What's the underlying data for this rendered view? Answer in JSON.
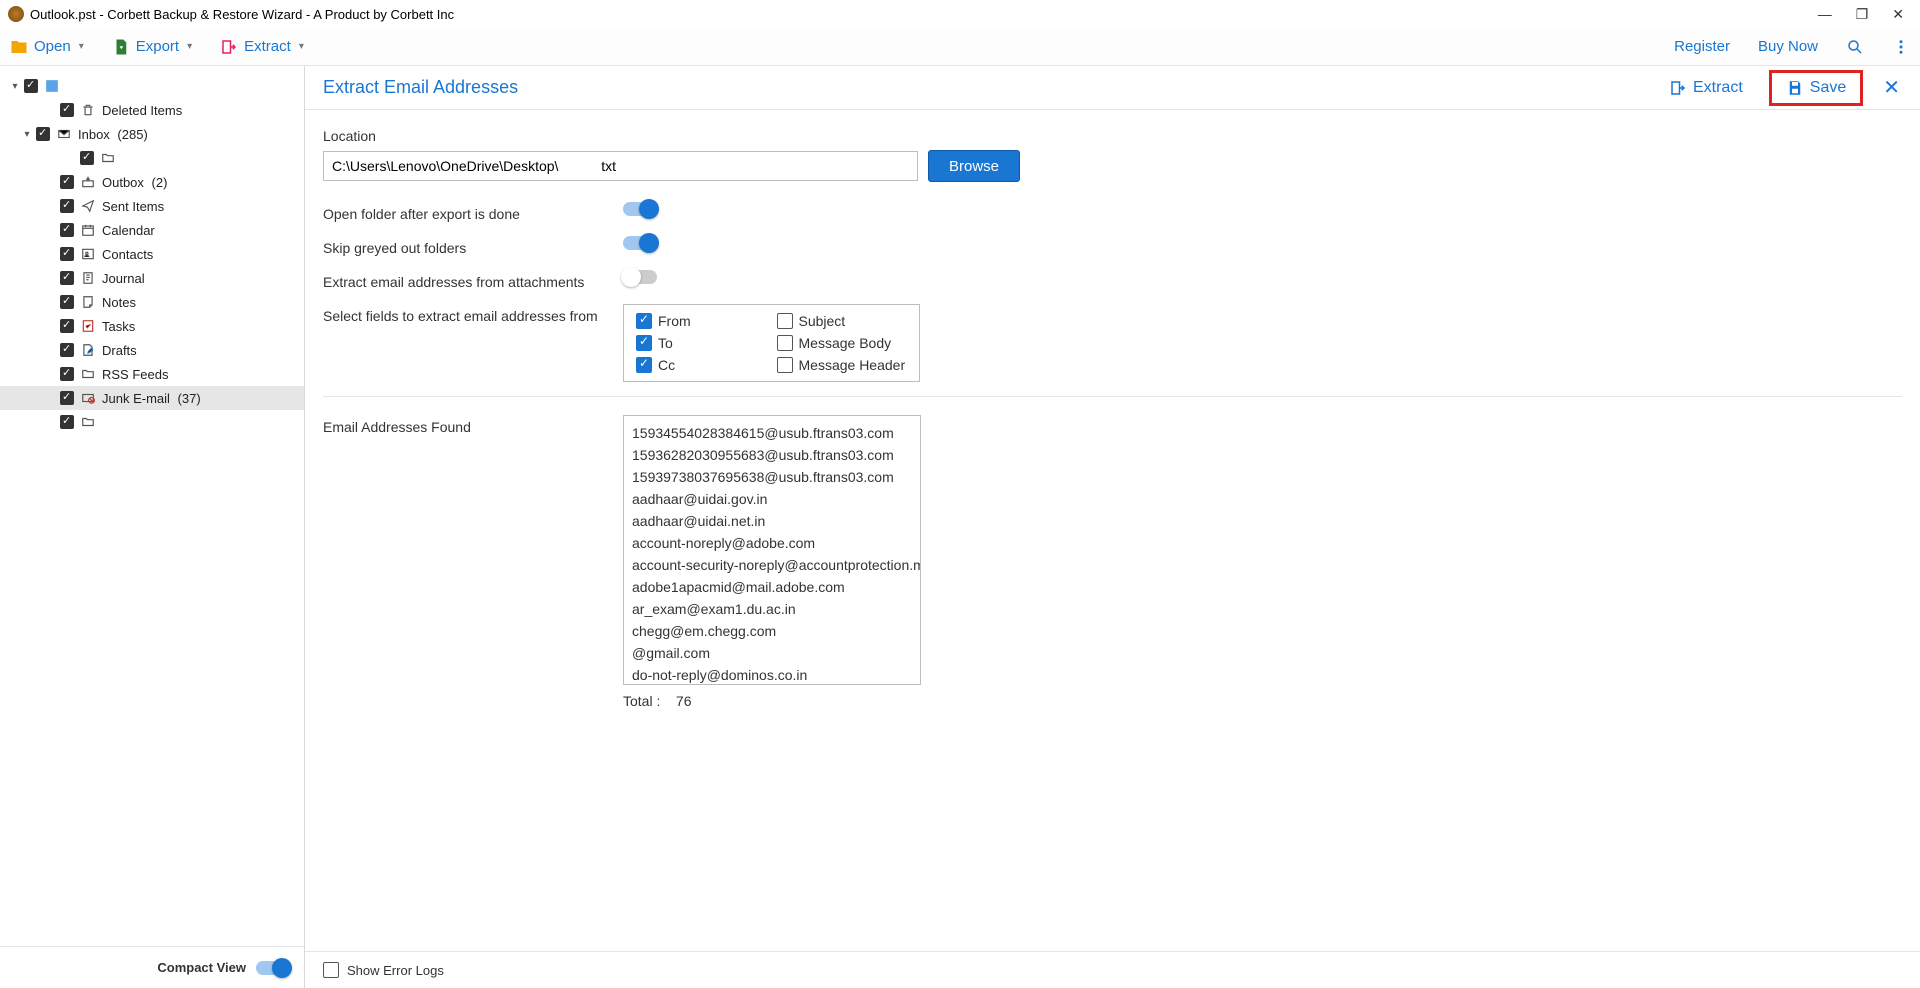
{
  "titlebar": {
    "text": "Outlook.pst - Corbett Backup & Restore Wizard - A Product by Corbett Inc"
  },
  "toolbar": {
    "open": "Open",
    "export": "Export",
    "extract": "Extract",
    "register": "Register",
    "buy_now": "Buy Now"
  },
  "tree": {
    "root_icon": "pst-file",
    "items": [
      {
        "label": "Deleted Items",
        "icon": "trash"
      },
      {
        "label": "Inbox",
        "count": "(285)",
        "icon": "envelope",
        "expander": "▾"
      },
      {
        "label": "",
        "icon": "folder",
        "indent": 3
      },
      {
        "label": "Outbox",
        "count": "(2)",
        "icon": "outbox"
      },
      {
        "label": "Sent Items",
        "icon": "sent"
      },
      {
        "label": "Calendar",
        "icon": "calendar"
      },
      {
        "label": "Contacts",
        "icon": "contacts"
      },
      {
        "label": "Journal",
        "icon": "journal"
      },
      {
        "label": "Notes",
        "icon": "notes"
      },
      {
        "label": "Tasks",
        "icon": "tasks"
      },
      {
        "label": "Drafts",
        "icon": "drafts"
      },
      {
        "label": "RSS Feeds",
        "icon": "folder"
      },
      {
        "label": "Junk E-mail",
        "count": "(37)",
        "icon": "junk",
        "selected": true
      },
      {
        "label": "",
        "icon": "folder"
      }
    ]
  },
  "sidebar_footer": {
    "compact_view": "Compact View"
  },
  "main_header": {
    "title": "Extract Email Addresses",
    "extract": "Extract",
    "save": "Save"
  },
  "form": {
    "location_label": "Location",
    "location_value": "C:\\Users\\Lenovo\\OneDrive\\Desktop\\           txt",
    "browse": "Browse",
    "open_after": "Open folder after export is done",
    "skip_greyed": "Skip greyed out folders",
    "extract_attach": "Extract email addresses from attachments",
    "select_fields": "Select fields to extract email addresses from",
    "fields": {
      "from": "From",
      "to": "To",
      "cc": "Cc",
      "subject": "Subject",
      "body": "Message Body",
      "header": "Message Header"
    },
    "found_label": "Email Addresses Found",
    "emails": [
      "15934554028384615@usub.ftrans03.com",
      "15936282030955683@usub.ftrans03.com",
      "15939738037695638@usub.ftrans03.com",
      "aadhaar@uidai.gov.in",
      "aadhaar@uidai.net.in",
      "account-noreply@adobe.com",
      "account-security-noreply@accountprotection.micro",
      "adobe1apacmid@mail.adobe.com",
      "ar_exam@exam1.du.ac.in",
      "chegg@em.chegg.com",
      "                         @gmail.com",
      "do-not-reply@dominos.co.in"
    ],
    "total_label": "Total :",
    "total_value": "76"
  },
  "footer": {
    "show_logs": "Show Error Logs"
  }
}
